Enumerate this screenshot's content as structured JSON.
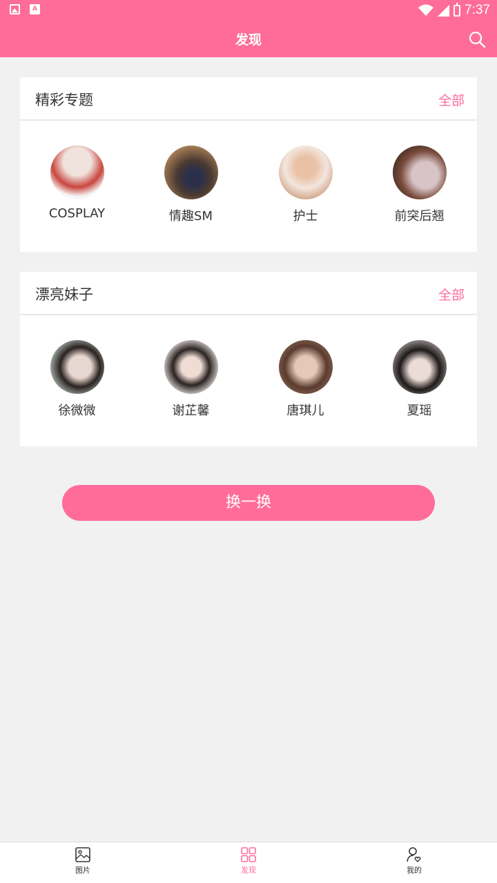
{
  "status_bar": {
    "time": "7:37",
    "notification_icons": [
      "image-icon",
      "font-icon"
    ],
    "font_icon_text": "A"
  },
  "app_bar": {
    "title": "发现",
    "search_icon": "search-icon"
  },
  "sections": [
    {
      "title": "精彩专题",
      "more_label": "全部",
      "items": [
        {
          "label": "COSPLAY",
          "colors": [
            "#c9463f",
            "#f0e2dc"
          ]
        },
        {
          "label": "情趣SM",
          "colors": [
            "#4b3a31",
            "#b58a5c"
          ]
        },
        {
          "label": "护士",
          "colors": [
            "#f3e6de",
            "#c99574"
          ]
        },
        {
          "label": "前突后翘",
          "colors": [
            "#3a231c",
            "#d8c3c6"
          ]
        }
      ]
    },
    {
      "title": "漂亮妹子",
      "more_label": "全部",
      "items": [
        {
          "label": "徐微微",
          "colors": [
            "#2a2220",
            "#e8d7d0"
          ]
        },
        {
          "label": "谢芷馨",
          "colors": [
            "#f7f2f0",
            "#2b2321"
          ]
        },
        {
          "label": "唐琪儿",
          "colors": [
            "#5b3b2e",
            "#e5c8b8"
          ]
        },
        {
          "label": "夏瑶",
          "colors": [
            "#1e1a1a",
            "#ecdcd7"
          ]
        }
      ]
    }
  ],
  "swap_button": {
    "label": "换一换"
  },
  "tab_bar": {
    "tabs": [
      {
        "label": "图片",
        "icon": "picture-icon",
        "active": false
      },
      {
        "label": "发现",
        "icon": "grid-icon",
        "active": true
      },
      {
        "label": "我的",
        "icon": "user-heart-icon",
        "active": false
      }
    ]
  },
  "colors": {
    "accent": "#ff6c9a",
    "background": "#f1f1f1",
    "card": "#ffffff"
  }
}
